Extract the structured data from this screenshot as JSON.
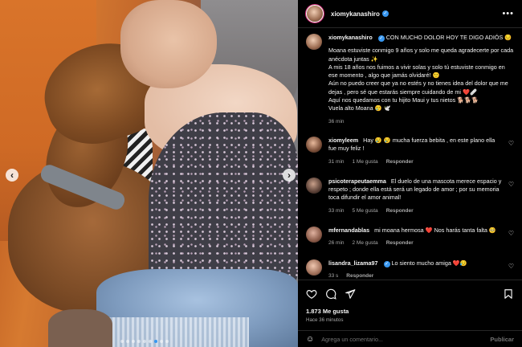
{
  "post": {
    "username": "xiomykanashiro",
    "verified": true,
    "caption_title": "CON MUCHO DOLOR HOY TE DIGO ADIÓS 😔",
    "caption_lines": [
      "Moana estuviste conmigo 9 años y solo me queda agradecerte por cada anécdota juntas ✨",
      "A mis 18 años nos fuimos a vivir solas y solo tú estuviste conmigo en ese momento , algo que jamás olvidaré! 🙂",
      "Aún no puedo creer que ya no estés y no tienes idea del dolor que me dejas , pero sé que estarás siempre cuidando de mi ❤️🩹",
      "Aquí nos quedamos con tu hijito Maui y tus nietos 🐕🐕🐕",
      "Vuela alto Moana 🥲 🕊️"
    ],
    "caption_time": "36 min"
  },
  "comments": [
    {
      "username": "xiomyleem",
      "verified": false,
      "text": "Hay 😢 😢 mucha fuerza bebita , en este plano ella fue muy feliz !",
      "time": "31 min",
      "likes": "1 Me gusta",
      "reply": "Responder"
    },
    {
      "username": "psicoterapeutaemma",
      "verified": false,
      "text": "El duelo de una mascota merece espacio y respeto ; donde ella está será un legado de amor ; por su memoria toca difundir el amor animal!",
      "time": "33 min",
      "likes": "5 Me gusta",
      "reply": "Responder"
    },
    {
      "username": "mfernandablas",
      "verified": false,
      "text": "mi moana hermosa ❤️ Nos harás tanta falta 🥺",
      "time": "26 min",
      "likes": "2 Me gusta",
      "reply": "Responder"
    },
    {
      "username": "lisandra_lizama97",
      "verified": true,
      "text": "Lo siento mucho amiga ❤️😥",
      "time": "33 s",
      "likes": "",
      "reply": "Responder"
    }
  ],
  "stats": {
    "likes": "1.873 Me gusta",
    "posted": "Hace 36 minutos"
  },
  "add_comment": {
    "placeholder": "Agrega un comentario...",
    "publish_label": "Publicar"
  },
  "media": {
    "prev_arrow": "‹",
    "next_arrow": "›",
    "carousel_total": 9,
    "carousel_active": 6
  },
  "icons": {
    "header_more": "more-icon",
    "like": "heart-icon",
    "comment": "comment-icon",
    "share": "send-icon",
    "save": "bookmark-icon",
    "emoji": "emoji-icon"
  },
  "colors": {
    "accent": "#3897f0",
    "background": "#000000"
  }
}
